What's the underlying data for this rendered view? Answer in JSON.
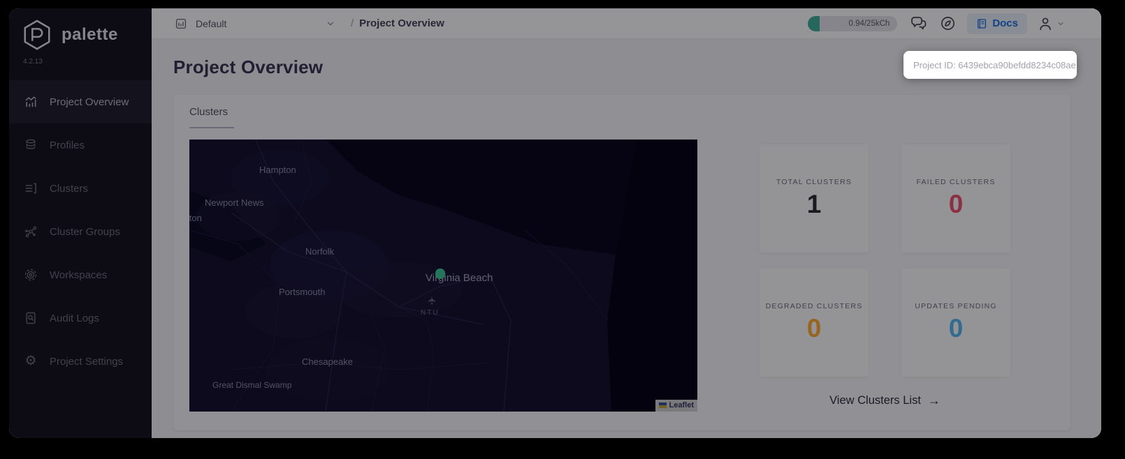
{
  "app": {
    "name": "palette",
    "version": "4.2.13"
  },
  "sidebar": {
    "items": [
      {
        "label": "Project Overview",
        "icon": "bar-chart-icon",
        "active": true
      },
      {
        "label": "Profiles",
        "icon": "layers-icon",
        "active": false
      },
      {
        "label": "Clusters",
        "icon": "list-icon",
        "active": false
      },
      {
        "label": "Cluster Groups",
        "icon": "nodes-icon",
        "active": false
      },
      {
        "label": "Workspaces",
        "icon": "concentric-circles-icon",
        "active": false
      },
      {
        "label": "Audit Logs",
        "icon": "document-search-icon",
        "active": false
      },
      {
        "label": "Project Settings",
        "icon": "gear-icon",
        "active": false
      }
    ]
  },
  "topbar": {
    "project_selector": {
      "value": "Default"
    },
    "breadcrumb": {
      "separator": "/",
      "current": "Project Overview"
    },
    "usage_badge": {
      "text": "0.94/25kCh",
      "accent_color": "#3fae9c"
    },
    "docs_button": {
      "label": "Docs",
      "color": "#1f6fe0"
    }
  },
  "page": {
    "title": "Project Overview",
    "project_id_tooltip": "Project ID: 6439ebca90befdd8234c08ae"
  },
  "clusters_section": {
    "tab_label": "Clusters",
    "map": {
      "labels": [
        "Hampton",
        "Newport News",
        "llton",
        "Norfolk",
        "Virginia Beach",
        "Portsmouth",
        "NTU",
        "Chesapeake",
        "Great Dismal Swamp"
      ],
      "marker_color": "#3fc79a",
      "attribution": "Leaflet"
    },
    "stats": [
      {
        "label": "TOTAL CLUSTERS",
        "value": "1",
        "color": "#2c2c33"
      },
      {
        "label": "FAILED CLUSTERS",
        "value": "0",
        "color": "#f0526e"
      },
      {
        "label": "DEGRADED CLUSTERS",
        "value": "0",
        "color": "#ffac35"
      },
      {
        "label": "UPDATES PENDING",
        "value": "0",
        "color": "#54b7f0"
      }
    ],
    "view_link": {
      "label": "View Clusters List",
      "arrow": "→"
    }
  }
}
